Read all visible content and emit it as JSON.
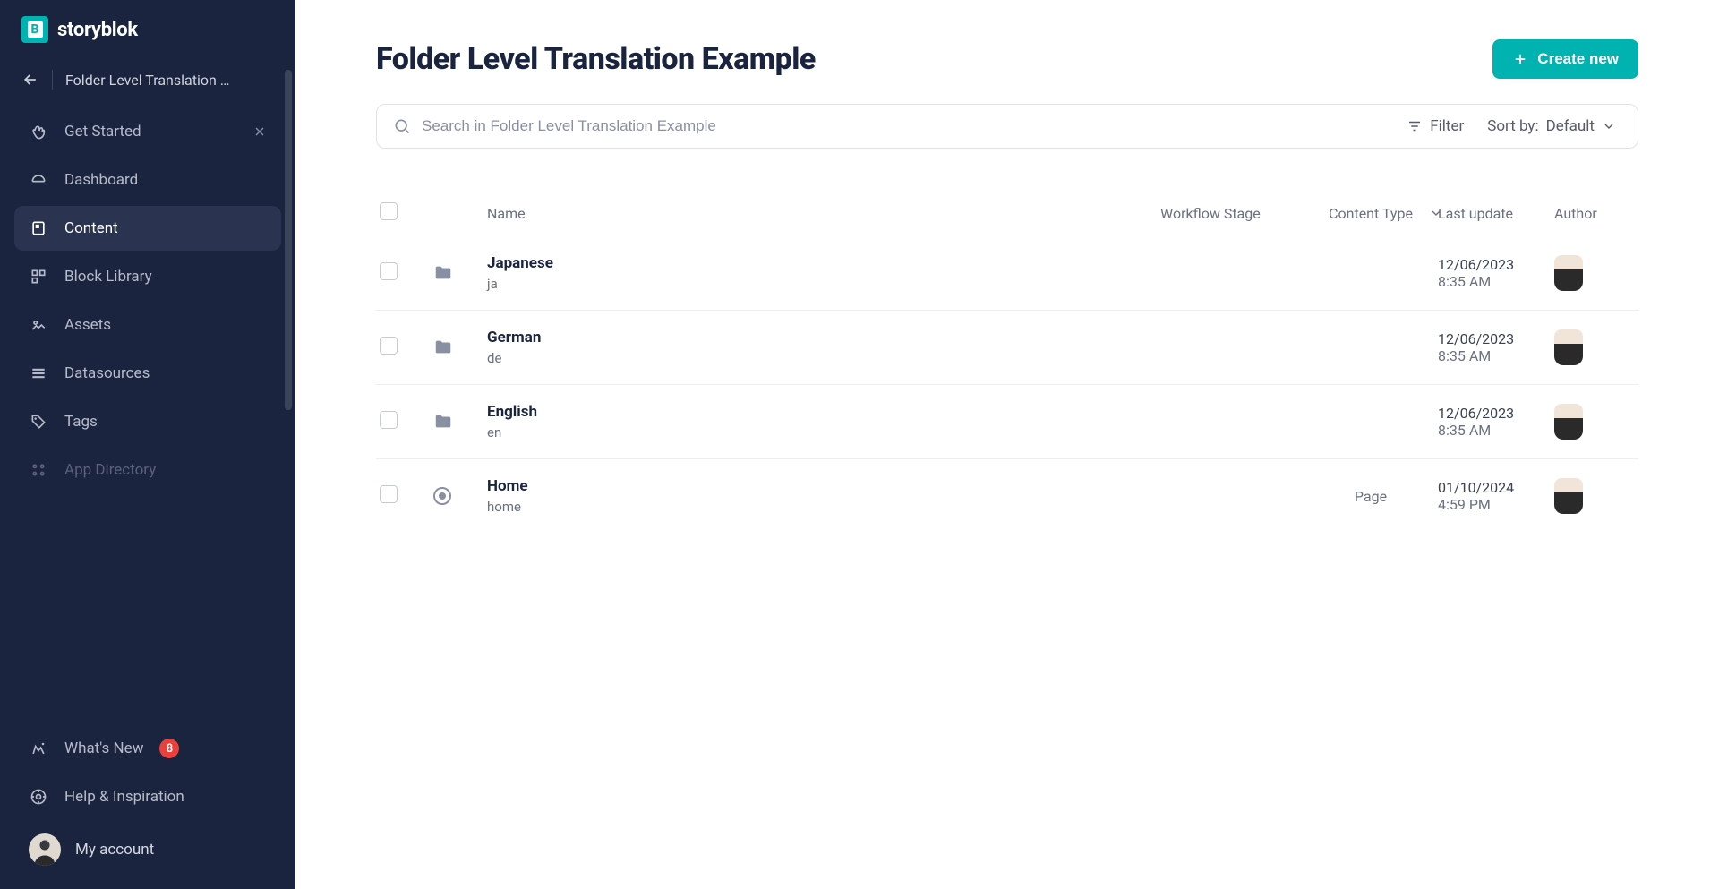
{
  "brand": {
    "name": "storyblok",
    "logo_letter": "B"
  },
  "breadcrumb": {
    "title": "Folder Level Translation …"
  },
  "sidebar": {
    "items": [
      {
        "label": "Get Started",
        "icon": "wave",
        "closable": true
      },
      {
        "label": "Dashboard",
        "icon": "dashboard"
      },
      {
        "label": "Content",
        "icon": "content",
        "active": true
      },
      {
        "label": "Block Library",
        "icon": "blocks"
      },
      {
        "label": "Assets",
        "icon": "assets"
      },
      {
        "label": "Datasources",
        "icon": "datasources"
      },
      {
        "label": "Tags",
        "icon": "tags"
      },
      {
        "label": "App Directory",
        "icon": "app-directory",
        "dim": true
      }
    ],
    "bottom": [
      {
        "label": "What's New",
        "icon": "whats-new",
        "badge": "8"
      },
      {
        "label": "Help & Inspiration",
        "icon": "help"
      }
    ],
    "account_label": "My account"
  },
  "page": {
    "title": "Folder Level Translation Example",
    "create_label": "Create new",
    "search_placeholder": "Search in Folder Level Translation Example",
    "filter_label": "Filter",
    "sort_prefix": "Sort by: ",
    "sort_value": "Default"
  },
  "table": {
    "columns": {
      "name": "Name",
      "workflow": "Workflow Stage",
      "content_type": "Content Type",
      "last_update": "Last update",
      "author": "Author"
    },
    "rows": [
      {
        "kind": "folder",
        "name": "Japanese",
        "slug": "ja",
        "content_type": "",
        "date": "12/06/2023",
        "time": "8:35 AM"
      },
      {
        "kind": "folder",
        "name": "German",
        "slug": "de",
        "content_type": "",
        "date": "12/06/2023",
        "time": "8:35 AM"
      },
      {
        "kind": "folder",
        "name": "English",
        "slug": "en",
        "content_type": "",
        "date": "12/06/2023",
        "time": "8:35 AM"
      },
      {
        "kind": "page",
        "name": "Home",
        "slug": "home",
        "content_type": "Page",
        "date": "01/10/2024",
        "time": "4:59 PM"
      }
    ]
  }
}
